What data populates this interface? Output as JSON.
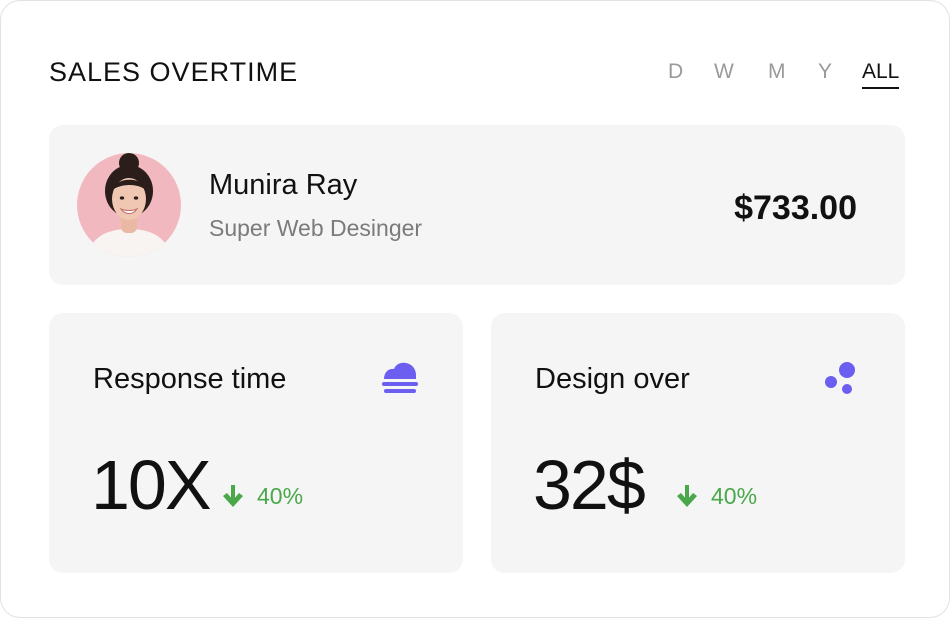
{
  "header": {
    "title": "SALES OVERTIME",
    "tabs": [
      {
        "label": "D",
        "active": false
      },
      {
        "label": "W",
        "active": false
      },
      {
        "label": "M",
        "active": false
      },
      {
        "label": "Y",
        "active": false
      },
      {
        "label": "ALL",
        "active": true
      }
    ]
  },
  "profile": {
    "name": "Munira Ray",
    "role": "Super Web Desinger",
    "amount": "$733.00",
    "avatar_bg": "#f2b8bf"
  },
  "stats": [
    {
      "label": "Response time",
      "icon": "cloud-fog-icon",
      "value": "10X",
      "change": "40%",
      "direction": "down"
    },
    {
      "label": "Design over",
      "icon": "bubbles-icon",
      "value": "32$",
      "change": "40%",
      "direction": "down"
    }
  ],
  "colors": {
    "accent": "#6b5ef0",
    "positive": "#4aa84a",
    "muted": "#9a9a9a",
    "card_bg": "#f5f5f5"
  }
}
